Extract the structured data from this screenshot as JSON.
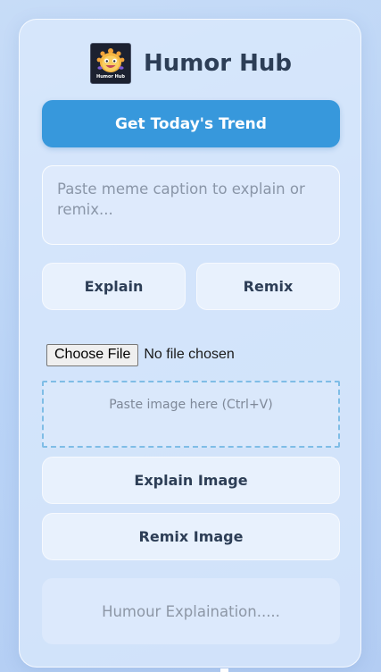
{
  "header": {
    "logo_text": "Humor Hub",
    "title": "Humor Hub"
  },
  "actions": {
    "trend_label": "Get Today's Trend",
    "explain_label": "Explain",
    "remix_label": "Remix",
    "explain_image_label": "Explain Image",
    "remix_image_label": "Remix Image"
  },
  "caption_input": {
    "value": "",
    "placeholder": "Paste meme caption to explain or remix..."
  },
  "file_picker": {
    "button_label": "Choose File",
    "status": "No file chosen"
  },
  "paste_zone": {
    "label": "Paste image here (Ctrl+V)"
  },
  "output": {
    "placeholder": "Humour Explaination....."
  },
  "colors": {
    "accent": "#3798dc",
    "title": "#2d3e56",
    "dashed_border": "#7fbde6"
  },
  "icons": {
    "logo": "cartoon-mascot-logo"
  }
}
